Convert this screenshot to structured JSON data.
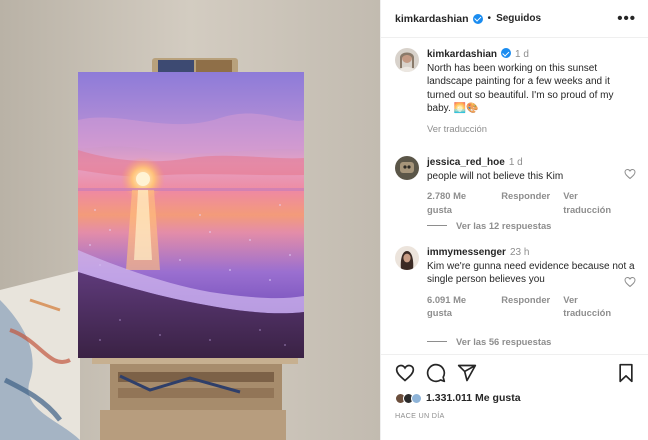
{
  "post": {
    "username": "kimkardashian",
    "separator": "•",
    "follow_status": "Seguidos",
    "more_icon": "ellipsis-icon"
  },
  "caption": {
    "username": "kimkardashian",
    "time": "1 d",
    "text": "North has been working on this sunset landscape painting for a few weeks and it turned out so beautiful. I'm so proud of my baby. 🌅🎨",
    "translate": "Ver traducción"
  },
  "comments": [
    {
      "username": "jessica_red_hoe",
      "time": "1 d",
      "text": "people will not believe this Kim",
      "likes": "2.780 Me gusta",
      "reply": "Responder",
      "translate": "Ver traducción",
      "replies": "Ver las 12 respuestas"
    },
    {
      "username": "immymessenger",
      "time": "23 h",
      "text": "Kim we're gunna need evidence because not a single person believes you",
      "likes": "6.091 Me gusta",
      "reply": "Responder",
      "translate": "Ver traducción",
      "replies": "Ver las 56 respuestas"
    }
  ],
  "footer": {
    "like_count": "1.331.011 Me gusta",
    "timestamp": "HACE UN DÍA",
    "icons": [
      "heart-icon",
      "comment-icon",
      "share-icon",
      "bookmark-icon"
    ]
  },
  "colors": {
    "verified": "#1a8cf0",
    "muted": "#8e8e8e",
    "text": "#262626"
  }
}
